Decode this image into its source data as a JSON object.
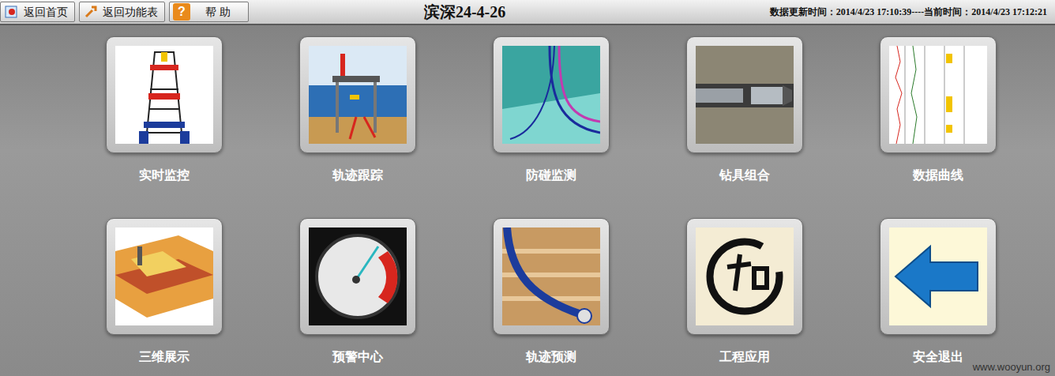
{
  "toolbar": {
    "buttons": [
      {
        "label": "返回首页",
        "icon": ""
      },
      {
        "label": "返回功能表",
        "icon": ""
      },
      {
        "label": "帮 助",
        "icon": "?"
      }
    ],
    "title": "滨深24-4-26",
    "time_info": "数据更新时间：2014/4/23 17:10:39----当前时间：2014/4/23 17:12:21"
  },
  "tiles": [
    {
      "label": "实时监控",
      "kind": "derrick"
    },
    {
      "label": "轨迹跟踪",
      "kind": "platform"
    },
    {
      "label": "防碰监测",
      "kind": "collision"
    },
    {
      "label": "钻具组合",
      "kind": "bit"
    },
    {
      "label": "数据曲线",
      "kind": "curves"
    },
    {
      "label": "三维展示",
      "kind": "model"
    },
    {
      "label": "预警中心",
      "kind": "gauge"
    },
    {
      "label": "轨迹预测",
      "kind": "wellpath"
    },
    {
      "label": "工程应用",
      "kind": "brush"
    },
    {
      "label": "安全退出",
      "kind": "exit"
    }
  ],
  "watermark": "www.wooyun.org"
}
